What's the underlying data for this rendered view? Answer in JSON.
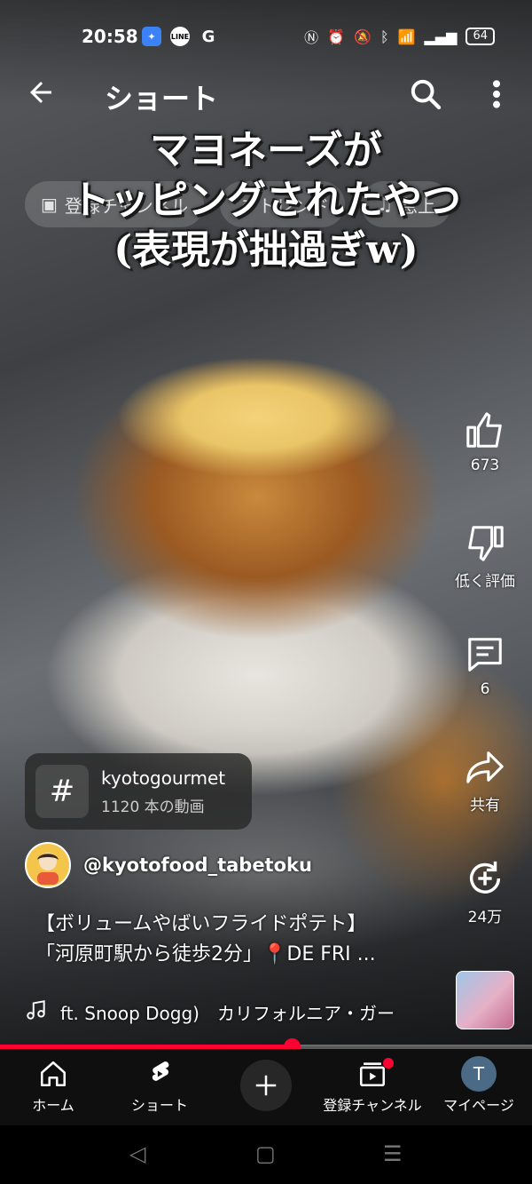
{
  "status_bar": {
    "time": "20:58",
    "app_icons": [
      "line-icon",
      "google-icon"
    ],
    "line_text": "LINE",
    "google_text": "G",
    "battery": "64"
  },
  "top_bar": {
    "title": "ショート"
  },
  "video_caption": {
    "line1": "マヨネーズが",
    "line2": "トッピングされたやつ",
    "line3": "(表現が拙過ぎw)"
  },
  "ghost_chips": {
    "chip1": "登録チャンネル",
    "chip2": "トレンド",
    "chip3": "急上"
  },
  "actions": {
    "like_count": "673",
    "dislike_label": "低く評価",
    "comments_count": "6",
    "share_label": "共有",
    "remix_count": "24万"
  },
  "hashtag": {
    "name": "kyotogourmet",
    "count": "1120 本の動画"
  },
  "channel": {
    "handle": "@kyotofood_tabetoku"
  },
  "description": {
    "line1": "【ボリュームやばいフライドポテト】",
    "line2": "「河原町駅から徒歩2分」📍DE FRI ..."
  },
  "music": {
    "text": "ft. Snoop Dogg)　カリフォルニア・ガー"
  },
  "progress": {
    "fraction": 0.55
  },
  "bottom_nav": {
    "home": "ホーム",
    "shorts": "ショート",
    "subscriptions": "登録チャンネル",
    "mypage": "マイページ",
    "mypage_initial": "T"
  },
  "colors": {
    "accent": "#ff0033",
    "nav_bg": "#0f0f0f"
  }
}
